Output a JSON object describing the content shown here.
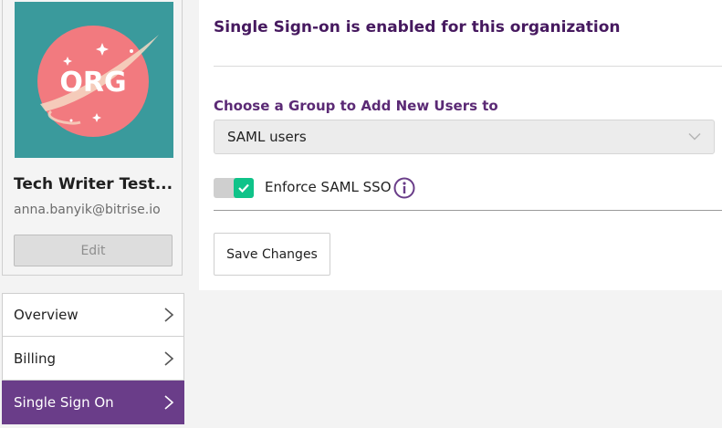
{
  "profile": {
    "avatar_text": "ORG",
    "org_name": "Tech Writer Test...",
    "email": "anna.banyik@bitrise.io",
    "edit_label": "Edit"
  },
  "nav": {
    "items": [
      {
        "label": "Overview",
        "active": false
      },
      {
        "label": "Billing",
        "active": false
      },
      {
        "label": "Single Sign On",
        "active": true
      }
    ]
  },
  "sso": {
    "status_title": "Single Sign-on is enabled for this organization",
    "group_label": "Choose a Group to Add New Users to",
    "group_selected": "SAML users",
    "enforce_label": "Enforce SAML SSO",
    "enforce_enabled": true,
    "save_label": "Save Changes"
  },
  "colors": {
    "accent_purple": "#6a3d89",
    "title_purple": "#46195f",
    "toggle_green": "#0fc389",
    "avatar_bg": "#3a9a9c",
    "avatar_circle": "#f27a7f"
  },
  "icons": {
    "nav_chevron": "chevron-right-icon",
    "select_chevron": "chevron-down-icon",
    "info": "info-icon",
    "toggle_check": "check-icon"
  }
}
